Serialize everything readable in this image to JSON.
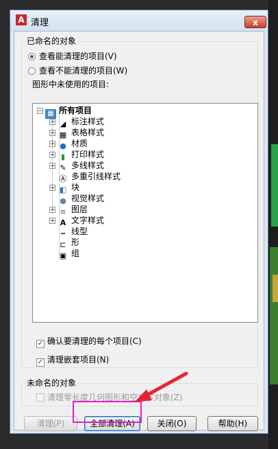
{
  "window": {
    "title": "清理",
    "app_icon_glyph": "A",
    "close_glyph": "x"
  },
  "named": {
    "group_label": "已命名的对象",
    "radio_can": "查看能清理的项目(V)",
    "radio_cannot": "查看不能清理的项目(W)",
    "tree_label": "图形中未使用的项目:"
  },
  "tree": {
    "root": "所有项目",
    "items": [
      {
        "label": "标注样式",
        "icon": "dimension-style-icon",
        "expandable": true
      },
      {
        "label": "表格样式",
        "icon": "table-style-icon",
        "expandable": true
      },
      {
        "label": "材质",
        "icon": "material-icon",
        "expandable": true
      },
      {
        "label": "打印样式",
        "icon": "plot-style-icon",
        "expandable": true
      },
      {
        "label": "多线样式",
        "icon": "multiline-style-icon",
        "expandable": true
      },
      {
        "label": "多重引线样式",
        "icon": "multileader-style-icon",
        "expandable": false
      },
      {
        "label": "块",
        "icon": "block-icon",
        "expandable": true
      },
      {
        "label": "视觉样式",
        "icon": "visual-style-icon",
        "expandable": false
      },
      {
        "label": "图层",
        "icon": "layer-icon",
        "expandable": true
      },
      {
        "label": "文字样式",
        "icon": "text-style-icon",
        "expandable": true
      },
      {
        "label": "线型",
        "icon": "linetype-icon",
        "expandable": false
      },
      {
        "label": "形",
        "icon": "shape-icon",
        "expandable": false
      },
      {
        "label": "组",
        "icon": "group-icon",
        "expandable": false
      }
    ]
  },
  "options": {
    "confirm": "确认要清理的每个项目(C)",
    "nested": "清理嵌套项目(N)"
  },
  "unnamed": {
    "group_label": "未命名的对象",
    "zero_length": "清理零长度几何图形和空文字对象(Z)"
  },
  "buttons": {
    "purge": "清理(P)",
    "purge_all": "全部清理(A)",
    "close": "关闭(O)",
    "help": "帮助(H)"
  },
  "colors": {
    "highlight": "#e91ccf",
    "arrow": "#e8232f"
  }
}
